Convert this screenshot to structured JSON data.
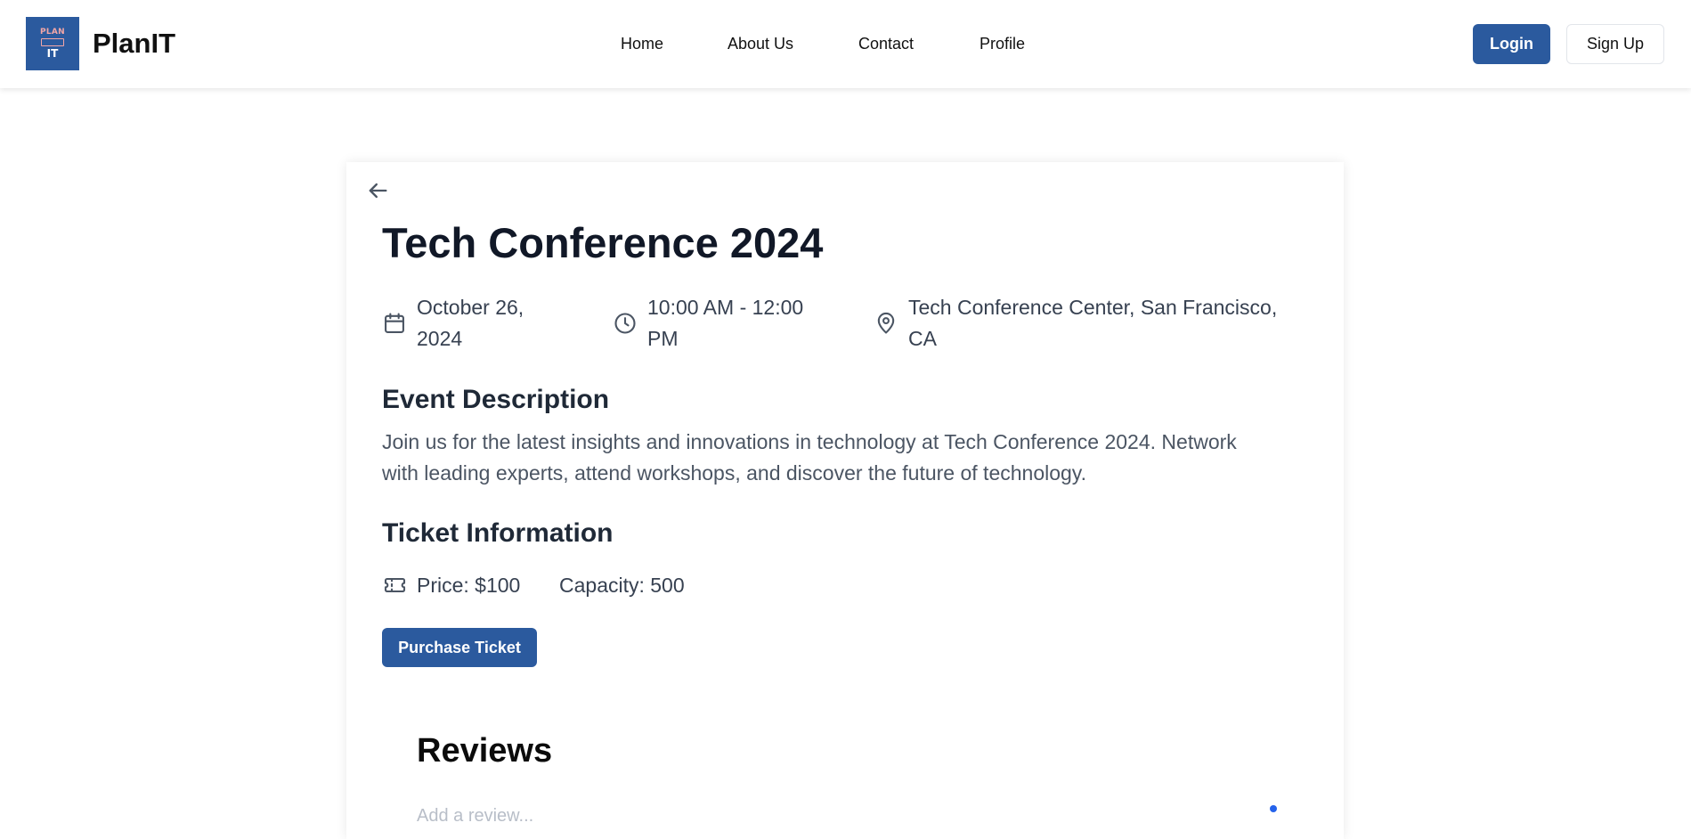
{
  "brand": {
    "name": "PlanIT",
    "logo_top": "PLAN",
    "logo_bottom": "IT"
  },
  "nav": {
    "items": [
      {
        "label": "Home"
      },
      {
        "label": "About Us"
      },
      {
        "label": "Contact"
      },
      {
        "label": "Profile"
      }
    ],
    "login_label": "Login",
    "signup_label": "Sign Up"
  },
  "event": {
    "back_icon": "arrow-left-icon",
    "title": "Tech Conference 2024",
    "date_line1": "October 26,",
    "date_line2": "2024",
    "time_line1": "10:00 AM - 12:00",
    "time_line2": "PM",
    "location_line1": "Tech Conference Center, San Francisco,",
    "location_line2": "CA",
    "description_heading": "Event Description",
    "description_line1": "Join us for the latest insights and innovations in technology at Tech Conference 2024. Network",
    "description_line2": "with leading experts, attend workshops, and discover the future of technology.",
    "ticket_heading": "Ticket Information",
    "price": "Price: $100",
    "capacity": "Capacity: 500",
    "purchase_label": "Purchase Ticket"
  },
  "reviews": {
    "heading": "Reviews",
    "input_placeholder": "Add a review..."
  },
  "colors": {
    "primary": "#2b5a9e",
    "text_dark": "#111827",
    "text_body": "#4b5563",
    "accent_dot": "#2563eb"
  }
}
